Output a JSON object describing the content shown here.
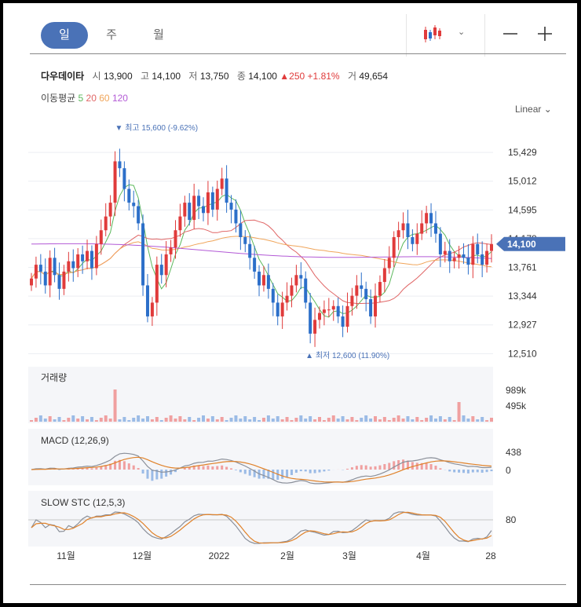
{
  "tabs": [
    "일",
    "주",
    "월"
  ],
  "active_tab": 0,
  "icons": {
    "chart_type": "candlestick-icon",
    "caret": "chevron-down-icon",
    "zoom_out": "minus-icon",
    "zoom_in": "plus-icon"
  },
  "quote": {
    "name": "다우데이타",
    "open_label": "시",
    "open": "13,900",
    "high_label": "고",
    "high": "14,100",
    "low_label": "저",
    "low": "13,750",
    "close_label": "종",
    "close": "14,100",
    "change": "▲250",
    "change_pct": "+1.81%",
    "volume_label": "거",
    "volume": "49,654"
  },
  "ma_legend": {
    "label": "이동평균",
    "periods": [
      "5",
      "20",
      "60",
      "120"
    ]
  },
  "scale_mode": "Linear",
  "colors": {
    "accent": "#4a72b7",
    "up": "#e03b3b",
    "down": "#2c6fc9",
    "ma5": "#5cb85c",
    "ma20": "#e06666",
    "ma60": "#f0a55a",
    "ma120": "#b35ad6",
    "macd": "#8a8f99",
    "signal": "#e0822a"
  },
  "chart_data": [
    {
      "type": "candlestick",
      "title": "",
      "y_ticks": [
        "15,429",
        "15,012",
        "14,595",
        "14,178",
        "13,761",
        "13,344",
        "12,927",
        "12,510"
      ],
      "ylim": [
        12400,
        16000
      ],
      "x_ticks": [
        "11월",
        "12월",
        "2022",
        "2월",
        "3월",
        "4월",
        "28"
      ],
      "current_price": "14,100",
      "annotations": {
        "high": "최고 15,600 (-9.62%)",
        "low": "최저 12,600 (11.90%)"
      },
      "close_series": [
        13600,
        13800,
        13700,
        13500,
        13900,
        13650,
        13450,
        13700,
        13850,
        13750,
        13950,
        13850,
        14000,
        13750,
        14100,
        14300,
        14500,
        14700,
        15300,
        15200,
        14900,
        14700,
        14650,
        14400,
        13500,
        13050,
        13250,
        13800,
        13650,
        13950,
        14050,
        14300,
        14500,
        14700,
        14450,
        14800,
        14650,
        14550,
        14850,
        14600,
        14900,
        15050,
        14700,
        14600,
        14400,
        14200,
        14100,
        13900,
        13700,
        13500,
        13650,
        13450,
        13250,
        13050,
        13250,
        13350,
        13500,
        13650,
        13600,
        13250,
        12800,
        13000,
        13100,
        13150,
        13150,
        13200,
        13050,
        12900,
        13200,
        13350,
        13500,
        13450,
        13300,
        13050,
        13350,
        13550,
        13750,
        13900,
        14200,
        14300,
        14400,
        14200,
        14100,
        14250,
        14400,
        14550,
        14400,
        14250,
        13950,
        14000,
        13850,
        13900,
        13950,
        13900,
        13800,
        14100,
        13950,
        13800,
        14000,
        14100
      ]
    },
    {
      "type": "bar",
      "title": "거래량",
      "y_ticks": [
        "989k",
        "495k"
      ]
    },
    {
      "type": "line",
      "title": "MACD (12,26,9)",
      "y_ticks": [
        "438",
        "0"
      ],
      "series": [
        {
          "values": []
        },
        {
          "values": []
        }
      ]
    },
    {
      "type": "line",
      "title": "SLOW STC (12,5,3)",
      "y_ticks": [
        "80"
      ],
      "series": [
        {
          "values": []
        },
        {
          "values": []
        }
      ]
    }
  ]
}
